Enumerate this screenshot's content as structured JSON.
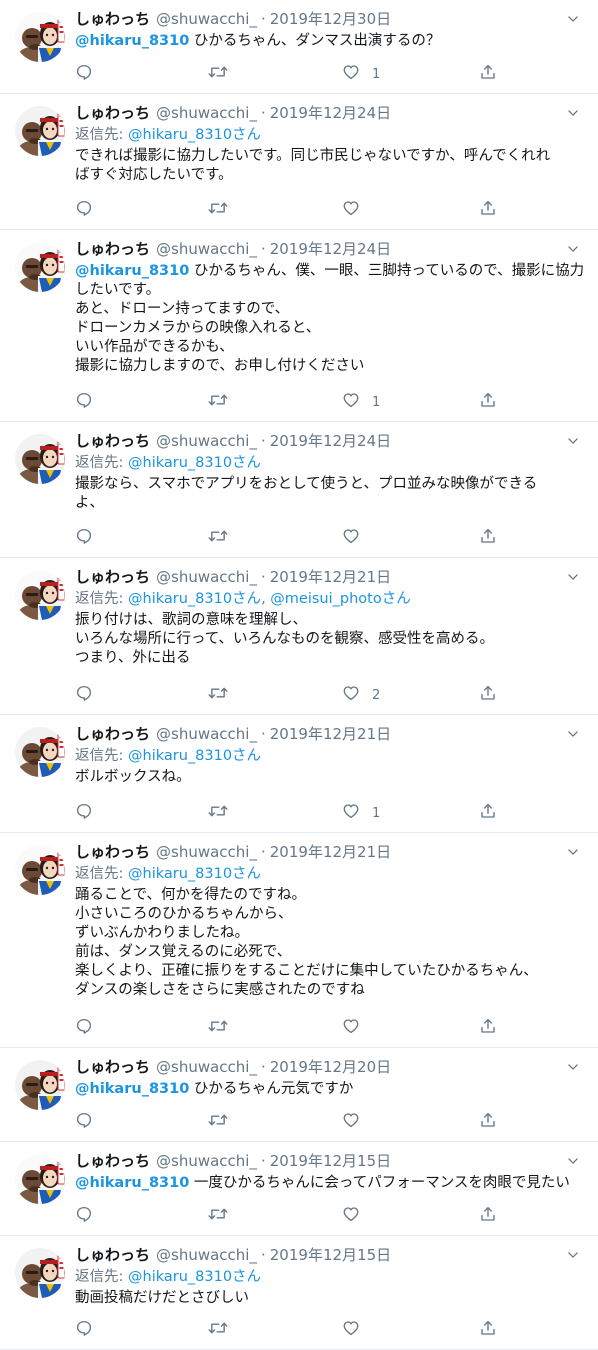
{
  "tweets": [
    {
      "name": "しゅわっち",
      "handle": "@shuwacchi_",
      "sep": "·",
      "date": "2019年12月30日",
      "reply_label": "",
      "reply_to": [],
      "lead_mention": "@hikaru_8310",
      "lines": [
        " ひかるちゃん、ダンマス出演するの？"
      ],
      "like_count": "1"
    },
    {
      "name": "しゅわっち",
      "handle": "@shuwacchi_",
      "sep": "·",
      "date": "2019年12月24日",
      "reply_label": "返信先:",
      "reply_to": [
        "@hikaru_8310さん"
      ],
      "lead_mention": "",
      "lines": [
        "できれば撮影に協力したいです。同じ市民じゃないですか、呼んでくれれ",
        "ばすぐ対応したいです。"
      ],
      "like_count": ""
    },
    {
      "name": "しゅわっち",
      "handle": "@shuwacchi_",
      "sep": "·",
      "date": "2019年12月24日",
      "reply_label": "",
      "reply_to": [],
      "lead_mention": "@hikaru_8310",
      "lines": [
        " ひかるちゃん、僕、一眼、三脚持っているので、撮影に協力",
        "したいです。",
        "あと、ドローン持ってますので、",
        "ドローンカメラからの映像入れると、",
        "いい作品ができるかも、",
        "撮影に協力しますので、お申し付けください"
      ],
      "like_count": "1"
    },
    {
      "name": "しゅわっち",
      "handle": "@shuwacchi_",
      "sep": "·",
      "date": "2019年12月24日",
      "reply_label": "返信先:",
      "reply_to": [
        "@hikaru_8310さん"
      ],
      "lead_mention": "",
      "lines": [
        "撮影なら、スマホでアプリをおとして使うと、プロ並みな映像ができる",
        "よ、"
      ],
      "like_count": ""
    },
    {
      "name": "しゅわっち",
      "handle": "@shuwacchi_",
      "sep": "·",
      "date": "2019年12月21日",
      "reply_label": "返信先:",
      "reply_to": [
        "@hikaru_8310さん",
        ", ",
        "@meisui_photoさん"
      ],
      "lead_mention": "",
      "lines": [
        "振り付けは、歌詞の意味を理解し、",
        "いろんな場所に行って、いろんなものを観察、感受性を高める。",
        "つまり、外に出る"
      ],
      "like_count": "2"
    },
    {
      "name": "しゅわっち",
      "handle": "@shuwacchi_",
      "sep": "·",
      "date": "2019年12月21日",
      "reply_label": "返信先:",
      "reply_to": [
        "@hikaru_8310さん"
      ],
      "lead_mention": "",
      "lines": [
        "ボルボックスね。"
      ],
      "like_count": "1"
    },
    {
      "name": "しゅわっち",
      "handle": "@shuwacchi_",
      "sep": "·",
      "date": "2019年12月21日",
      "reply_label": "返信先:",
      "reply_to": [
        "@hikaru_8310さん"
      ],
      "lead_mention": "",
      "lines": [
        "踊ることで、何かを得たのですね。",
        "小さいころのひかるちゃんから、",
        "ずいぶんかわりましたね。",
        "前は、ダンス覚えるのに必死で、",
        "楽しくより、正確に振りをすることだけに集中していたひかるちゃん、",
        "ダンスの楽しさをさらに実感されたのですね"
      ],
      "like_count": ""
    },
    {
      "name": "しゅわっち",
      "handle": "@shuwacchi_",
      "sep": "·",
      "date": "2019年12月20日",
      "reply_label": "",
      "reply_to": [],
      "lead_mention": "@hikaru_8310",
      "lines": [
        " ひかるちゃん元気ですか"
      ],
      "like_count": ""
    },
    {
      "name": "しゅわっち",
      "handle": "@shuwacchi_",
      "sep": "·",
      "date": "2019年12月15日",
      "reply_label": "",
      "reply_to": [],
      "lead_mention": "@hikaru_8310",
      "lines": [
        " 一度ひかるちゃんに会ってパフォーマンスを肉眼で見たい"
      ],
      "like_count": ""
    },
    {
      "name": "しゅわっち",
      "handle": "@shuwacchi_",
      "sep": "·",
      "date": "2019年12月15日",
      "reply_label": "返信先:",
      "reply_to": [
        "@hikaru_8310さん"
      ],
      "lead_mention": "",
      "lines": [
        "動画投稿だけだとさびしい"
      ],
      "like_count": ""
    }
  ],
  "icons": {
    "reply": "reply-icon",
    "retweet": "retweet-icon",
    "like": "heart-icon",
    "share": "share-icon",
    "caret": "chevron-down-icon"
  },
  "colors": {
    "text": "#14171a",
    "secondary": "#657786",
    "link": "#1b95e0",
    "divider": "#e6ecf0",
    "icon": "#657786"
  }
}
